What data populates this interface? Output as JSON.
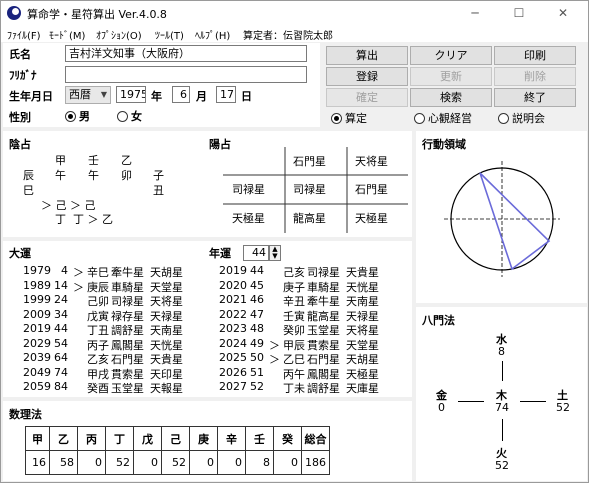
{
  "window": {
    "title": "算命学・星符算出 Ver.4.0.8",
    "min": "─",
    "max": "☐",
    "close": "✕"
  },
  "menu": [
    "ﾌｧｲﾙ(F)",
    "ﾓｰﾄﾞ(M)",
    "ｵﾌﾟｼｮﾝ(O)",
    "ﾂｰﾙ(T)",
    "ﾍﾙﾌﾟ(H)",
    "算定者：伝習院太郎"
  ],
  "form": {
    "name_label": "氏名",
    "name_value": "吉村洋文知事（大阪府）",
    "kana_label": "ﾌﾘｶﾞﾅ",
    "kana_value": "",
    "dob_label": "生年月日",
    "era": "西暦",
    "year": "1975",
    "year_unit": "年",
    "month": "6",
    "month_unit": "月",
    "day": "17",
    "day_unit": "日",
    "gender_label": "性別",
    "male": "男",
    "female": "女"
  },
  "buttons": {
    "calc": "算出",
    "clear": "クリア",
    "print": "印刷",
    "register": "登録",
    "update": "更新",
    "delete": "削除",
    "confirm": "確定",
    "search": "検索",
    "exit": "終了"
  },
  "mode": {
    "santei": "算定",
    "shinkan": "心観経営",
    "setsumei": "説明会"
  },
  "inzen": {
    "title": "陰占",
    "row1": [
      "甲",
      "壬",
      "乙"
    ],
    "row2": [
      "辰",
      "午",
      "午",
      "卯",
      "子"
    ],
    "row3a": "巳",
    "row3b": "丑",
    "row4": "＞ 己 ＞ 己",
    "row5": "丁  丁 ＞ 乙"
  },
  "yosen": {
    "title": "陽占",
    "cells": [
      "石門星",
      "天将星",
      "司禄星",
      "司禄星",
      "石門星",
      "天極星",
      "龍高星",
      "天極星"
    ]
  },
  "koudou": {
    "title": "行動領域"
  },
  "taiun": {
    "title": "大運",
    "nenun_label": "年運",
    "nenun_value": "44",
    "left": [
      [
        "1979",
        "4",
        "＞",
        "辛巳",
        "牽牛星",
        "天胡星"
      ],
      [
        "1989",
        "14",
        "＞",
        "庚辰",
        "車騎星",
        "天堂星"
      ],
      [
        "1999",
        "24",
        "",
        "己卯",
        "司禄星",
        "天将星"
      ],
      [
        "2009",
        "34",
        "",
        "戊寅",
        "禄存星",
        "天禄星"
      ],
      [
        "2019",
        "44",
        "",
        "丁丑",
        "調舒星",
        "天南星"
      ],
      [
        "2029",
        "54",
        "",
        "丙子",
        "鳳閣星",
        "天恍星"
      ],
      [
        "2039",
        "64",
        "",
        "乙亥",
        "石門星",
        "天貴星"
      ],
      [
        "2049",
        "74",
        "",
        "甲戌",
        "貫索星",
        "天印星"
      ],
      [
        "2059",
        "84",
        "",
        "癸酉",
        "玉堂星",
        "天報星"
      ]
    ],
    "right": [
      [
        "2019",
        "44",
        "",
        "己亥",
        "司禄星",
        "天貴星"
      ],
      [
        "2020",
        "45",
        "",
        "庚子",
        "車騎星",
        "天恍星"
      ],
      [
        "2021",
        "46",
        "",
        "辛丑",
        "牽牛星",
        "天南星"
      ],
      [
        "2022",
        "47",
        "",
        "壬寅",
        "龍高星",
        "天禄星"
      ],
      [
        "2023",
        "48",
        "",
        "癸卯",
        "玉堂星",
        "天将星"
      ],
      [
        "2024",
        "49",
        "＞",
        "甲辰",
        "貫索星",
        "天堂星"
      ],
      [
        "2025",
        "50",
        "＞",
        "乙巳",
        "石門星",
        "天胡星"
      ],
      [
        "2026",
        "51",
        "",
        "丙午",
        "鳳閣星",
        "天極星"
      ],
      [
        "2027",
        "52",
        "",
        "丁未",
        "調舒星",
        "天庫星"
      ]
    ]
  },
  "hachimon": {
    "title": "八門法",
    "water_label": "水",
    "water_value": "8",
    "wood_label": "木",
    "wood_value": "74",
    "metal_label": "金",
    "metal_value": "0",
    "earth_label": "土",
    "earth_value": "52",
    "fire_label": "火",
    "fire_value": "52"
  },
  "suuri": {
    "title": "数理法",
    "headers": [
      "甲",
      "乙",
      "丙",
      "丁",
      "戊",
      "己",
      "庚",
      "辛",
      "壬",
      "癸",
      "総合"
    ],
    "values": [
      "16",
      "58",
      "0",
      "52",
      "0",
      "52",
      "0",
      "0",
      "8",
      "0",
      "186"
    ]
  }
}
